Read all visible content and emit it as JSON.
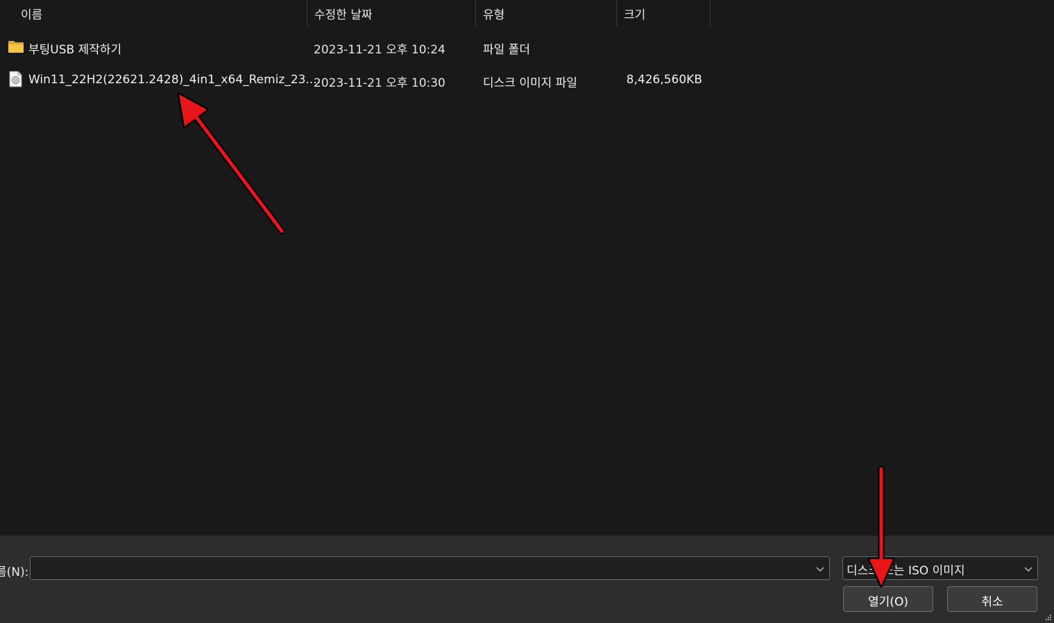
{
  "header": {
    "columns": [
      {
        "label": "이름"
      },
      {
        "label": "수정한 날짜"
      },
      {
        "label": "유형"
      },
      {
        "label": "크기"
      }
    ],
    "sort_glyph": "^"
  },
  "files": [
    {
      "icon": "folder-icon",
      "name": "부팅USB 제작하기",
      "modified": "2023-11-21 오후 10:24",
      "type": "파일 폴더",
      "size": ""
    },
    {
      "icon": "disc-image-file-icon",
      "name": "Win11_22H2(22621.2428)_4in1_x64_Remiz_23....",
      "modified": "2023-11-21 오후 10:30",
      "type": "디스크 이미지 파일",
      "size": "8,426,560KB"
    }
  ],
  "footer": {
    "filename_label": "름(N):",
    "filename_value": "",
    "filetype_selected": "디스크 또는 ISO 이미지",
    "open_button": "열기(O)",
    "cancel_button": "취소"
  },
  "colors": {
    "background": "#191919",
    "footer_background": "#2d2d2d",
    "annotation_arrow": "#e8151b",
    "folder": "#f5c542"
  }
}
